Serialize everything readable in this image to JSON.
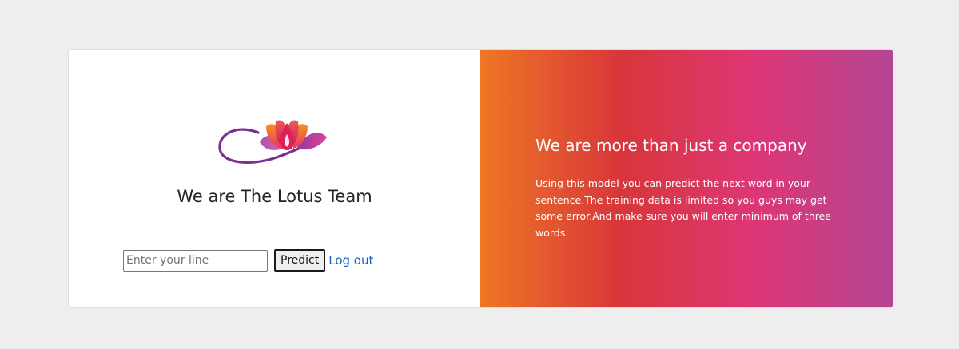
{
  "left_panel": {
    "logo_icon": "lotus-logo-icon",
    "team_title": "We are The Lotus Team",
    "form": {
      "line_input_placeholder": "Enter your line",
      "line_input_value": "",
      "predict_label": "Predict",
      "logout_label": "Log out"
    }
  },
  "right_panel": {
    "title": "We are more than just a company",
    "description": "Using this model you can predict the next word in your sentence.The training data is limited so you guys may get some error.And make sure you will enter minimum of three words."
  },
  "colors": {
    "page_background": "#eeeeee",
    "gradient_start": "#ee7724",
    "gradient_mid1": "#d8363a",
    "gradient_mid2": "#dd3675",
    "gradient_end": "#b44593",
    "link": "#1565c0"
  }
}
